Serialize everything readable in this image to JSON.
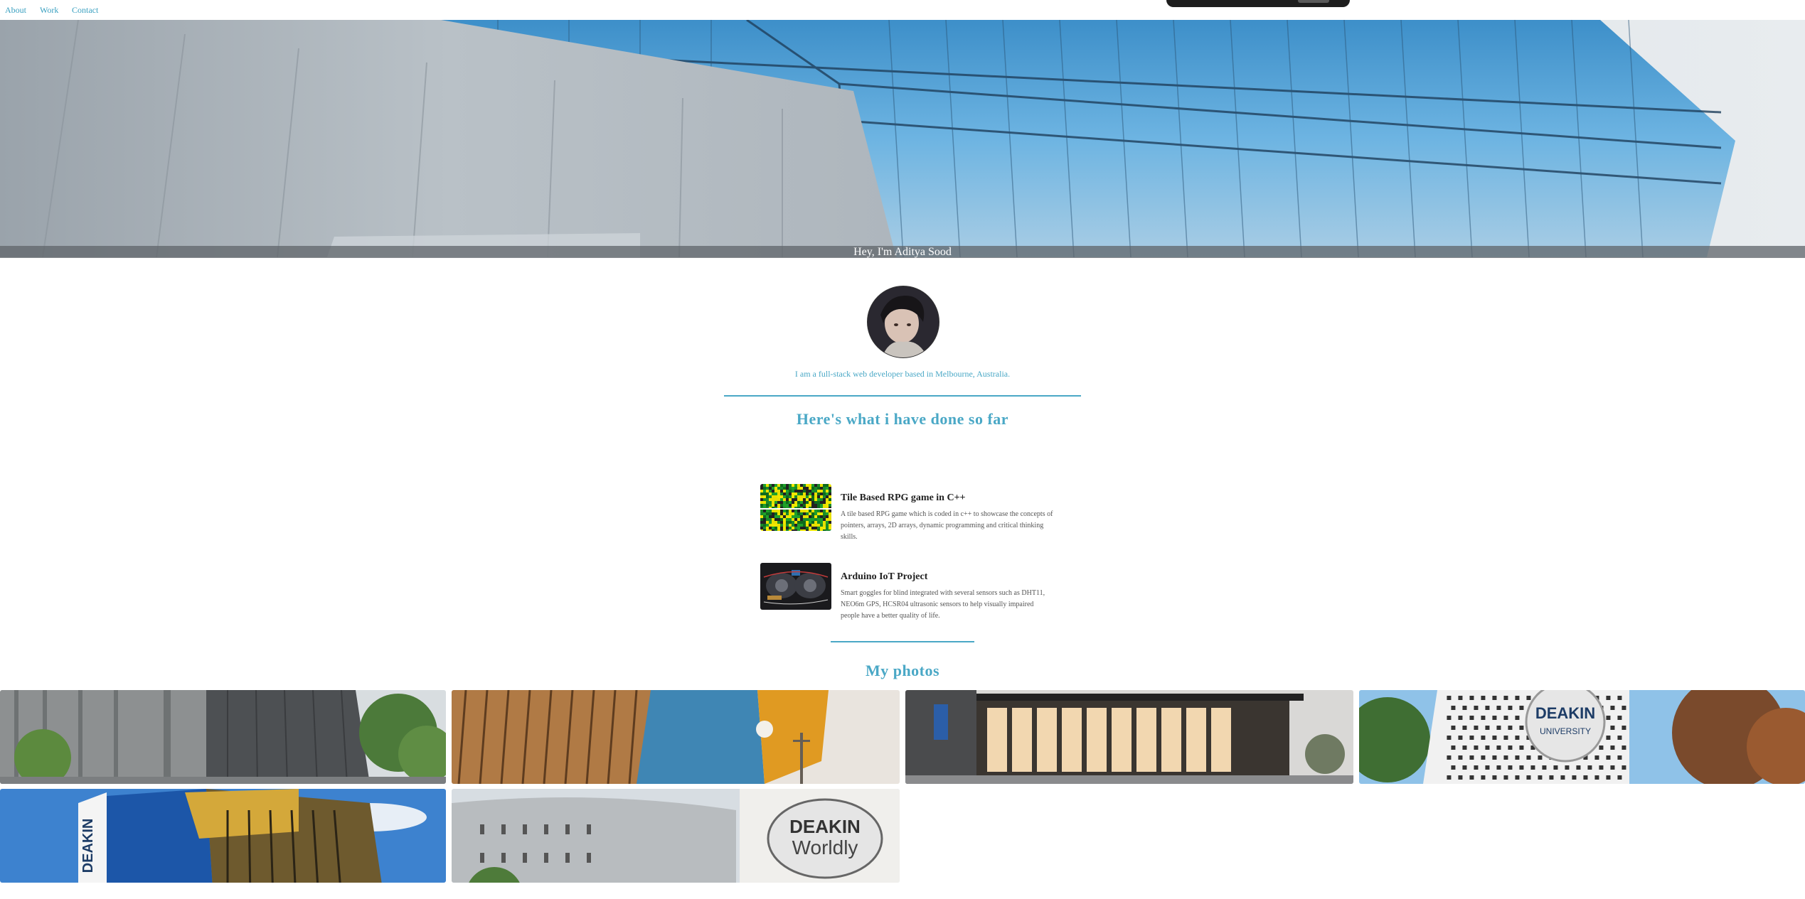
{
  "nav": {
    "links": [
      "About",
      "Work",
      "Contact"
    ]
  },
  "hero": {
    "caption": "Hey, I'm Aditya Sood"
  },
  "profile": {
    "bio": "I am a full-stack web developer based in Melbourne, Australia."
  },
  "work": {
    "title": "Here's what i have done so far",
    "projects": [
      {
        "title": "Tile Based RPG game in C++",
        "description": "A tile based RPG game which is coded in c++ to showcase the concepts of pointers, arrays, 2D arrays, dynamic programming and critical thinking skills."
      },
      {
        "title": "Arduino IoT Project",
        "description": "Smart goggles for blind integrated with several sensors such as DHT11, NEO6m GPS, HCSR04 ultrasonic sensors to help visually impaired people have a better quality of life."
      }
    ]
  },
  "photos": {
    "title": "My photos",
    "signs": {
      "deakin_university": [
        "DEAKIN",
        "UNIVERSITY"
      ],
      "deakin_worldly": [
        "DEAKIN",
        "Worldly"
      ],
      "deakin_tower": "DEAKIN"
    }
  },
  "colors": {
    "accent": "#4aa8c6",
    "link": "#3aa0c0",
    "caption_bar": "#5f6469"
  }
}
